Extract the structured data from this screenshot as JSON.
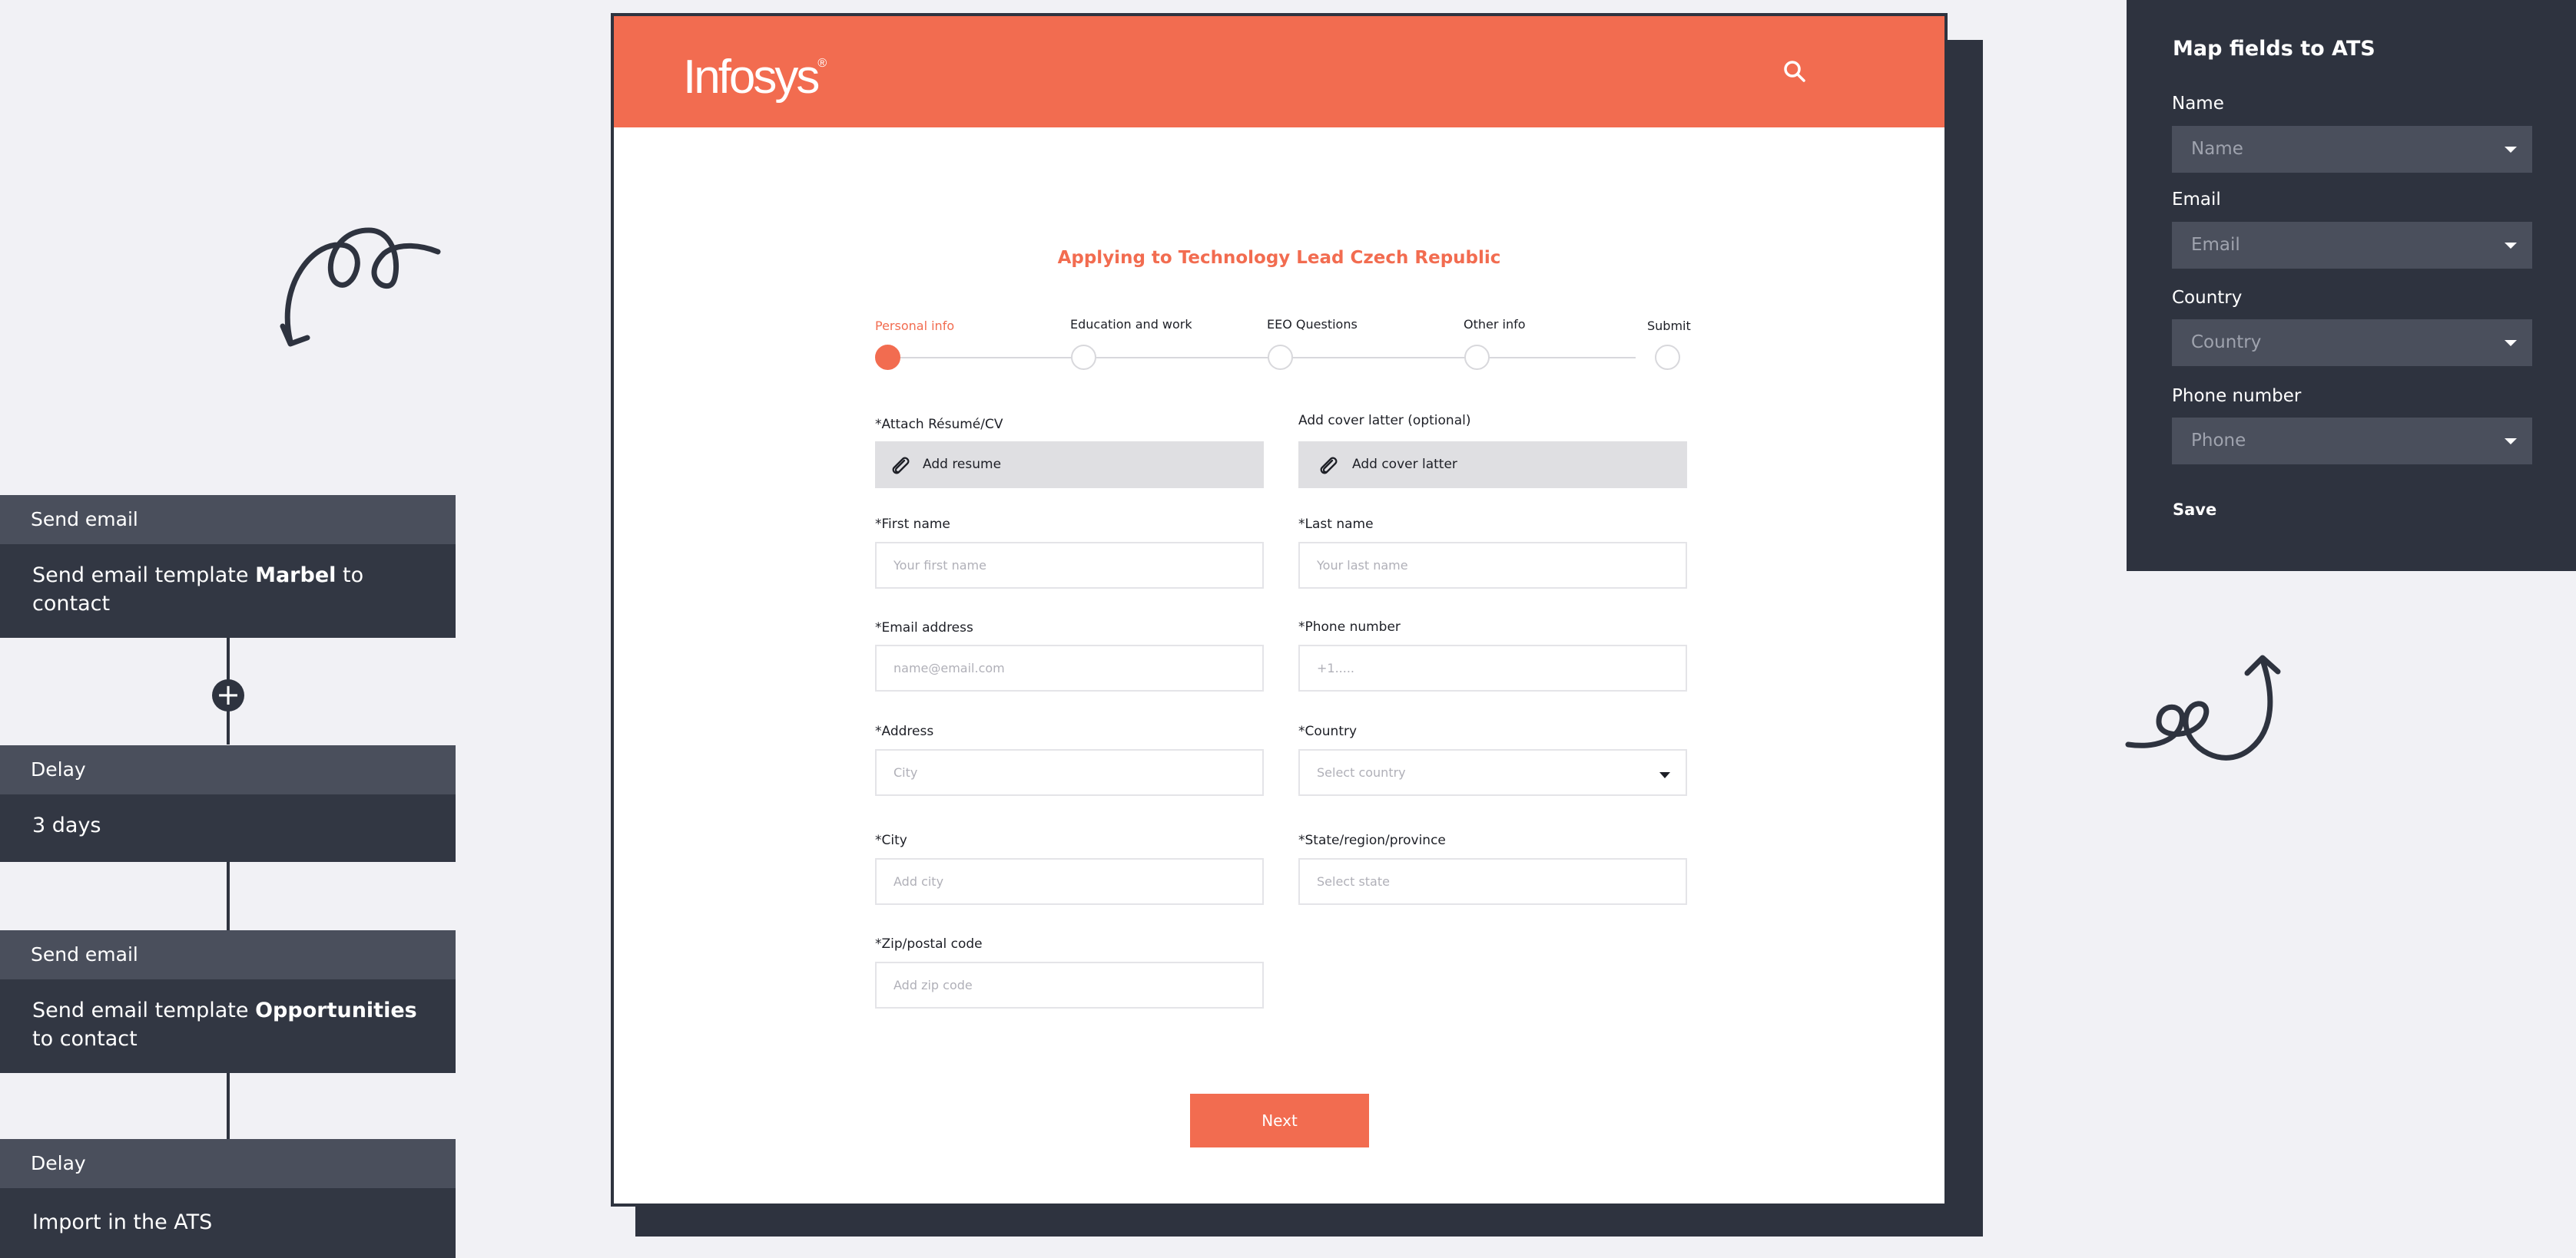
{
  "workflow": {
    "steps": [
      {
        "header": "Send email",
        "body_pre": "Send email template ",
        "body_bold": "Marbel",
        "body_post": " to contact"
      },
      {
        "header": "Delay",
        "body_pre": "3 days",
        "body_bold": "",
        "body_post": ""
      },
      {
        "header": "Send email",
        "body_pre": "Send email template ",
        "body_bold": "Opportunities",
        "body_post": " to contact"
      },
      {
        "header": "Delay",
        "body_pre": "Import in the ATS",
        "body_bold": "",
        "body_post": ""
      }
    ],
    "add_symbol": "+"
  },
  "site": {
    "logo": "Infosys",
    "logo_mark": "®",
    "form_title": "Applying to Technology Lead Czech Republic",
    "steps": [
      "Personal info",
      "Education and work",
      "EEO Questions",
      "Other info",
      "Submit"
    ],
    "active_step": 0,
    "fields": {
      "resume_label": "*Attach Résumé/CV",
      "resume_button": "Add resume",
      "cover_label": "Add cover latter (optional)",
      "cover_button": "Add cover latter",
      "first_name_label": "*First name",
      "first_name_placeholder": "Your first name",
      "last_name_label": "*Last name",
      "last_name_placeholder": "Your last name",
      "email_label": "*Email address",
      "email_placeholder": "name@email.com",
      "phone_label": "*Phone number",
      "phone_placeholder": "+1.....",
      "address_label": "*Address",
      "address_placeholder": "City",
      "country_label": "*Country",
      "country_placeholder": "Select country",
      "city_label": "*City",
      "city_placeholder": "Add city",
      "state_label": "*State/region/province",
      "state_placeholder": "Select state",
      "zip_label": "*Zip/postal code",
      "zip_placeholder": "Add zip code"
    },
    "next_button": "Next"
  },
  "ats": {
    "title": "Map fields to ATS",
    "fields": [
      {
        "label": "Name",
        "value": "Name"
      },
      {
        "label": "Email",
        "value": "Email"
      },
      {
        "label": "Country",
        "value": "Country"
      },
      {
        "label": "Phone number",
        "value": "Phone"
      }
    ],
    "save_label": "Save"
  },
  "colors": {
    "accent": "#f26c50",
    "dark": "#2e333f",
    "panel_head": "#4a4f5c"
  }
}
